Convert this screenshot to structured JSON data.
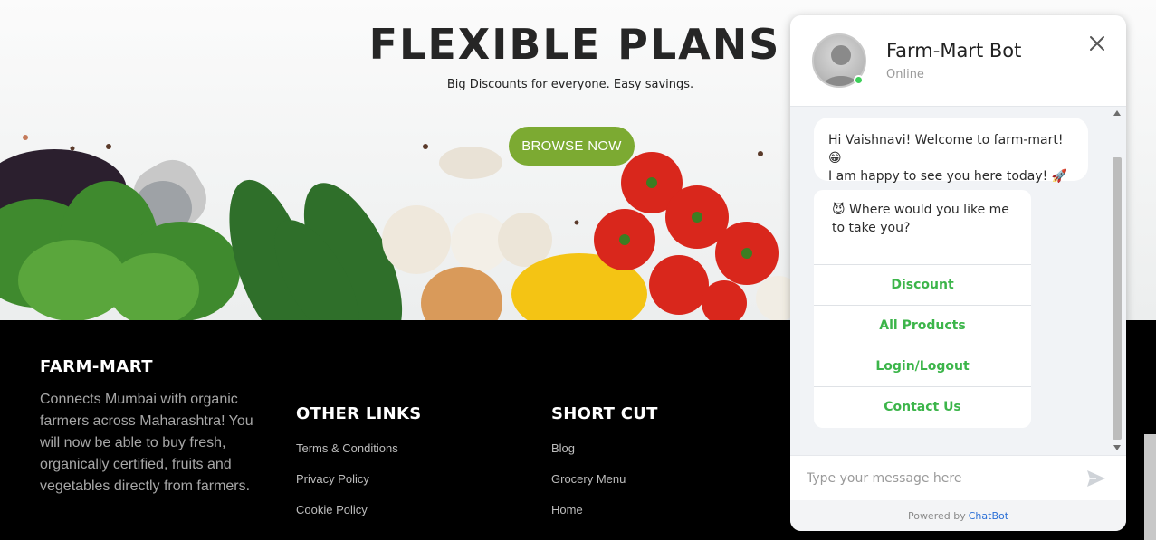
{
  "hero": {
    "title": "FLEXIBLE PLANS",
    "subtitle": "Big Discounts for everyone. Easy savings.",
    "cta_label": "BROWSE NOW"
  },
  "footer": {
    "brand": "FARM-MART",
    "description": "Connects Mumbai with organic farmers across Maharashtra! You will now be able to buy fresh, organically certified, fruits and vegetables directly from farmers.",
    "other_links": {
      "title": "OTHER LINKS",
      "items": [
        "Terms & Conditions",
        "Privacy Policy",
        "Cookie Policy"
      ]
    },
    "short_cut": {
      "title": "SHORT CUT",
      "items": [
        "Blog",
        "Grocery Menu",
        "Home"
      ]
    }
  },
  "chat": {
    "bot_name": "Farm-Mart Bot",
    "status": "Online",
    "messages": [
      {
        "text_line1": "Hi Vaishnavi! Welcome to farm-mart! 😁",
        "text_line2": "I am happy to see you here today! 🚀"
      },
      {
        "text": "😈 Where would you like me to take you?"
      }
    ],
    "options": [
      "Discount",
      "All Products",
      "Login/Logout",
      "Contact Us"
    ],
    "input_placeholder": "Type your message here",
    "powered_prefix": "Powered by",
    "powered_brand": "ChatBot",
    "colors": {
      "online": "#3ecf5a",
      "option_text": "#3cb54a",
      "brand_link": "#2a6fd6",
      "cta": "#7caa32"
    }
  }
}
